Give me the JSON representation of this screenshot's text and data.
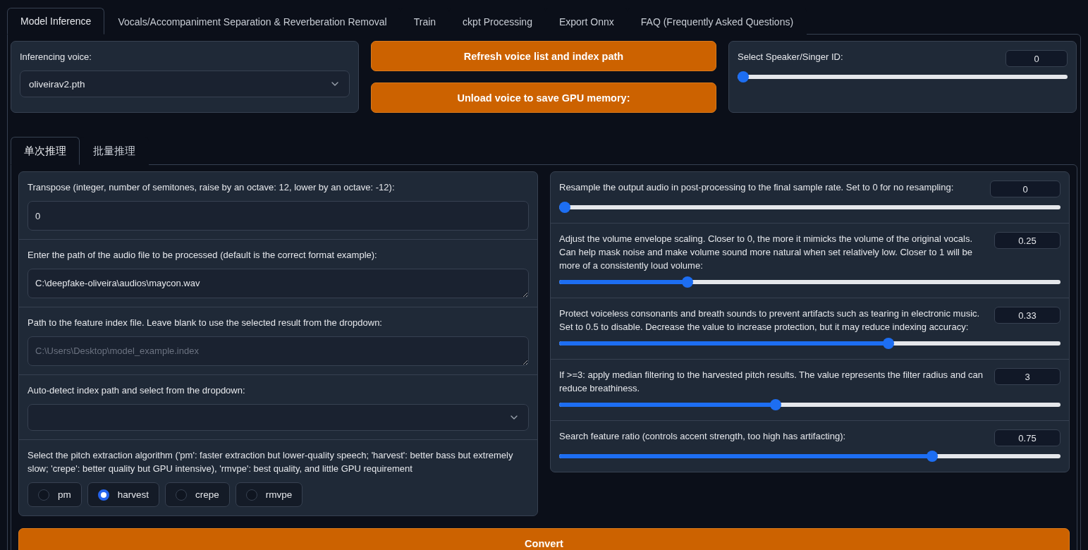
{
  "tabs": [
    {
      "label": "Model Inference",
      "selected": true
    },
    {
      "label": "Vocals/Accompaniment Separation & Reverberation Removal",
      "selected": false
    },
    {
      "label": "Train",
      "selected": false
    },
    {
      "label": "ckpt Processing",
      "selected": false
    },
    {
      "label": "Export Onnx",
      "selected": false
    },
    {
      "label": "FAQ (Frequently Asked Questions)",
      "selected": false
    }
  ],
  "voice": {
    "label": "Inferencing voice:",
    "value": "oliveirav2.pth"
  },
  "buttons": [
    "Refresh voice list and index path",
    "Unload voice to save GPU memory:"
  ],
  "speaker": {
    "label": "Select Speaker/Singer ID:",
    "value": "0",
    "level": 0
  },
  "sub_tabs": [
    {
      "label": "单次推理",
      "selected": true
    },
    {
      "label": "批量推理",
      "selected": false
    }
  ],
  "transpose": {
    "label": "Transpose (integer, number of semitones, raise by an octave: 12, lower by an octave: -12):",
    "value": "0"
  },
  "audio_path": {
    "label": "Enter the path of the audio file to be processed (default is the correct format example):",
    "value": "C:\\deepfake-oliveira\\audios\\maycon.wav"
  },
  "index_path": {
    "label": "Path to the feature index file. Leave blank to use the selected result from the dropdown:",
    "placeholder": "C:\\Users\\Desktop\\model_example.index"
  },
  "auto_index": {
    "label": "Auto-detect index path and select from the dropdown:"
  },
  "pitch": {
    "label": "Select the pitch extraction algorithm ('pm': faster extraction but lower-quality speech; 'harvest': better bass but extremely slow; 'crepe': better quality but GPU intensive), 'rmvpe': best quality, and little GPU requirement",
    "options": [
      {
        "label": "pm",
        "selected": false
      },
      {
        "label": "harvest",
        "selected": true
      },
      {
        "label": "crepe",
        "selected": false
      },
      {
        "label": "rmvpe",
        "selected": false
      }
    ]
  },
  "sliders": [
    {
      "label": "Resample the output audio in post-processing to the final sample rate. Set to 0 for no resampling:",
      "value": "0",
      "level": 0
    },
    {
      "label": "Adjust the volume envelope scaling. Closer to 0, the more it mimicks the volume of the original vocals. Can help mask noise and make volume sound more natural when set relatively low. Closer to 1 will be more of a consistently loud volume:",
      "value": "0.25",
      "level": 0.25
    },
    {
      "label": "Protect voiceless consonants and breath sounds to prevent artifacts such as tearing in electronic music. Set to 0.5 to disable. Decrease the value to increase protection, but it may reduce indexing accuracy:",
      "value": "0.33",
      "level": 0.66
    },
    {
      "label": "If >=3: apply median filtering to the harvested pitch results. The value represents the filter radius and can reduce breathiness.",
      "value": "3",
      "level": 0.43
    },
    {
      "label": "Search feature ratio (controls accent strength, too high has artifacting):",
      "value": "0.75",
      "level": 0.75
    }
  ],
  "convert_button": "Convert"
}
